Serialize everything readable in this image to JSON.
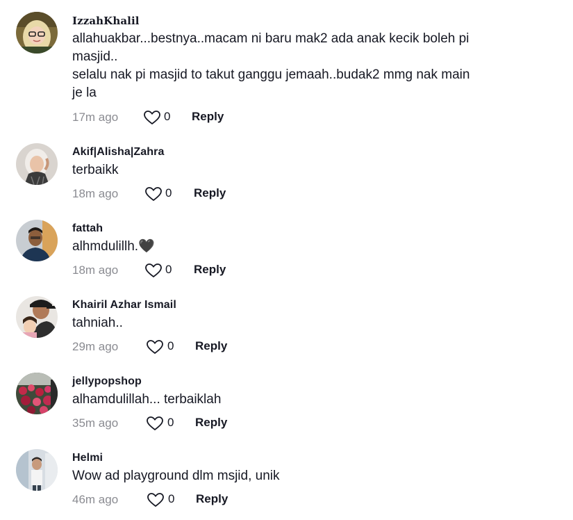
{
  "comments": [
    {
      "username": "IzzahKhalil",
      "lines": [
        "allahuakbar...bestnya..macam ni baru mak2 ada anak kecik boleh pi",
        "masjid..",
        "selalu nak pi masjid to takut ganggu jemaah..budak2 mmg nak main",
        "je la"
      ],
      "time": "17m ago",
      "likes": "0",
      "reply": "Reply"
    },
    {
      "username": "Akif|Alisha|Zahra",
      "lines": [
        "terbaikk"
      ],
      "time": "18m ago",
      "likes": "0",
      "reply": "Reply"
    },
    {
      "username": "fattah",
      "lines": [
        "alhmdulillh.🖤"
      ],
      "time": "18m ago",
      "likes": "0",
      "reply": "Reply"
    },
    {
      "username": "Khairil Azhar Ismail",
      "lines": [
        "tahniah.."
      ],
      "time": "29m ago",
      "likes": "0",
      "reply": "Reply"
    },
    {
      "username": "jellypopshop",
      "lines": [
        "alhamdulillah... terbaiklah"
      ],
      "time": "35m ago",
      "likes": "0",
      "reply": "Reply"
    },
    {
      "username": "Helmi",
      "lines": [
        "Wow ad playground dlm msjid, unik"
      ],
      "time": "46m ago",
      "likes": "0",
      "reply": "Reply"
    }
  ],
  "icons": {
    "like": "heart-outline-icon"
  },
  "colors": {
    "text": "#161823",
    "muted": "#8a8b91"
  }
}
